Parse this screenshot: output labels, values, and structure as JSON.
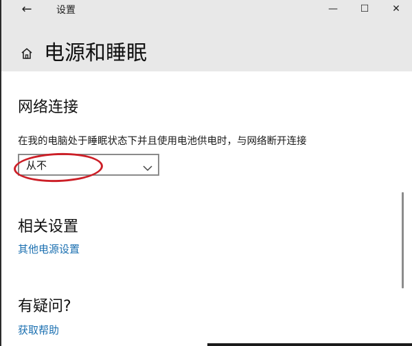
{
  "window": {
    "title": "设置",
    "back_icon": "back-arrow-icon",
    "controls": {
      "minimize": "—",
      "maximize": "☐",
      "close": "✕"
    }
  },
  "header": {
    "home_icon": "home-icon",
    "title": "电源和睡眠"
  },
  "network": {
    "heading": "网络连接",
    "description": "在我的电脑处于睡眠状态下并且使用电池供电时，与网络断开连接",
    "select_value": "从不"
  },
  "related": {
    "heading": "相关设置",
    "link": "其他电源设置"
  },
  "help": {
    "heading": "有疑问?",
    "link": "获取帮助"
  },
  "colors": {
    "titlebar_bg": "#e8e8e8",
    "link": "#1a6fb0",
    "annotation": "#cc1f27"
  }
}
